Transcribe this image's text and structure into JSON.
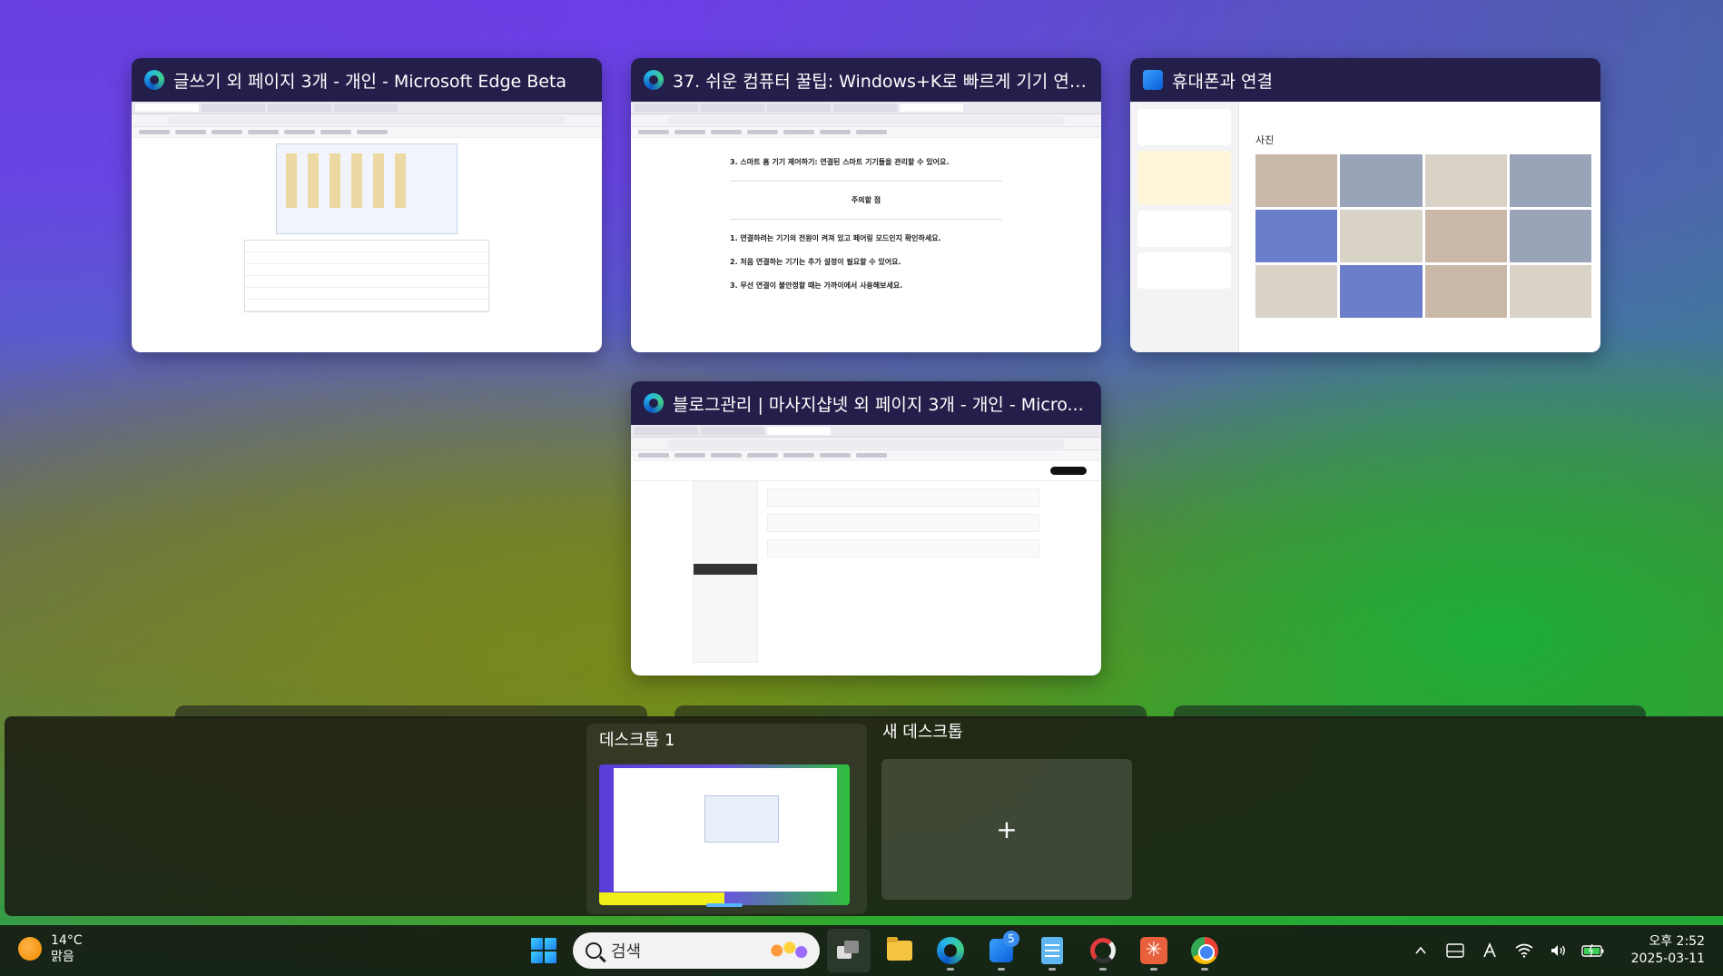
{
  "windows": [
    {
      "title": "글쓰기 외 페이지 3개 - 개인 - Microsoft Edge Beta",
      "app": "edge-icon"
    },
    {
      "title": "37. 쉬운 컴퓨터 꿀팁: Windows+K로 빠르게 기기 연결...",
      "app": "edge-icon",
      "content_lines": [
        "3. 스마트 홈 기기 제어하기: 연결된 스마트 기기들을 관리할 수 있어요.",
        "주의할 점",
        "1. 연결하려는 기기의 전원이 켜져 있고 페어링 모드인지 확인하세요.",
        "2. 처음 연결하는 기기는 추가 설정이 필요할 수 있어요.",
        "3. 무선 연결이 불안정할 때는 가까이에서 사용해보세요."
      ]
    },
    {
      "title": "휴대폰과 연결",
      "app": "phone-link-icon",
      "section_title": "사진"
    },
    {
      "title": "블로그관리 | 마사지샵넷 외 페이지 3개 - 개인 - Micro...",
      "app": "edge-icon"
    }
  ],
  "desktops": {
    "items": [
      {
        "label": "데스크톱 1",
        "selected": true
      }
    ],
    "new_label": "새 데스크톱",
    "new_symbol": "+"
  },
  "taskbar": {
    "weather": {
      "temp": "14°C",
      "condition": "맑음"
    },
    "search_placeholder": "검색",
    "phone_badge": "5",
    "clock": {
      "time": "오후 2:52",
      "date": "2025-03-11"
    }
  },
  "colors": {
    "wallpaper_top": "#6b3fe6",
    "wallpaper_bottom": "#22b036",
    "title_bar": "#241f4a",
    "accent": "#56b4ff"
  }
}
